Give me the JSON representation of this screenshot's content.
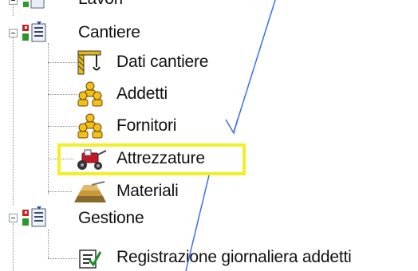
{
  "tree": {
    "nodes": [
      {
        "label": "Lavori",
        "icon": "group-icon"
      },
      {
        "label": "Cantiere",
        "icon": "group-icon",
        "expanded": true
      },
      {
        "label": "Dati cantiere",
        "icon": "crane-icon"
      },
      {
        "label": "Addetti",
        "icon": "workers-icon"
      },
      {
        "label": "Fornitori",
        "icon": "workers-icon"
      },
      {
        "label": "Attrezzature",
        "icon": "vehicle-icon",
        "highlighted": true
      },
      {
        "label": "Materiali",
        "icon": "materials-icon"
      },
      {
        "label": "Gestione",
        "icon": "group-icon",
        "expanded": true
      },
      {
        "label": "Registrazione giornaliera addetti",
        "icon": "checklist-icon"
      }
    ]
  },
  "colors": {
    "highlight": "#f2ef27",
    "annotation_lines": "#3d6fe0"
  }
}
